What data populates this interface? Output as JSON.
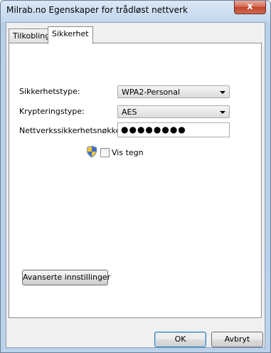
{
  "window": {
    "title": "Milrab.no Egenskaper for trådløst nettverk",
    "close_label": "x"
  },
  "tabs": [
    {
      "label": "Tilkobling",
      "selected": false
    },
    {
      "label": "Sikkerhet",
      "selected": true
    }
  ],
  "security": {
    "type_label": "Sikkerhetstype:",
    "type_value": "WPA2-Personal",
    "encryption_label": "Krypteringstype:",
    "encryption_value": "AES",
    "key_label": "Nettverkssikkerhetsnøkkel",
    "key_value": "●●●●●●●●",
    "show_chars_label": "Vis tegn",
    "show_chars_checked": false
  },
  "advanced_button_label": "Avanserte innstillinger",
  "footer": {
    "ok_label": "OK",
    "cancel_label": "Avbryt"
  }
}
